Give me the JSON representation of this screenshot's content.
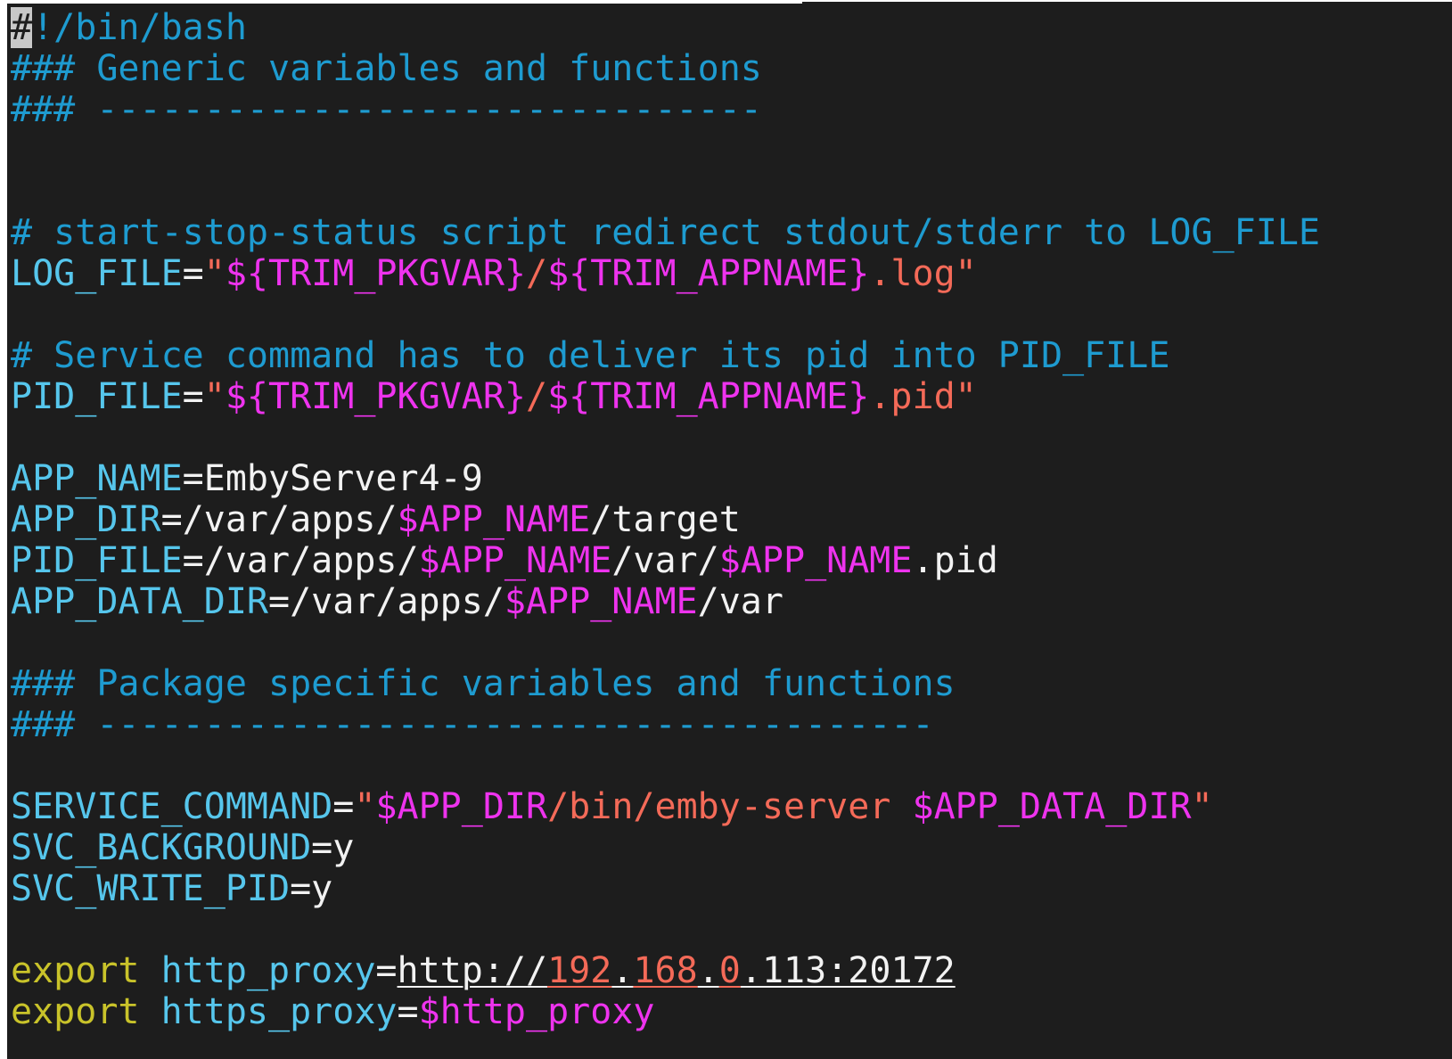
{
  "theme": {
    "background": "#1d1d1d",
    "text": "#f2f2f2",
    "comment": "#1e9bd0",
    "variable": "#56c6ec",
    "substitution": "#ee33ee",
    "string": "#f46a58",
    "keyword": "#c9c32a",
    "cursor": "#c8c8c8"
  },
  "editor": {
    "lines": [
      [
        {
          "t": "#",
          "c": "cursor"
        },
        {
          "t": "!/bin/bash",
          "c": "comment"
        }
      ],
      [
        {
          "t": "### Generic variables and functions",
          "c": "comment"
        }
      ],
      [
        {
          "t": "### -------------------------------",
          "c": "comment"
        }
      ],
      [],
      [],
      [
        {
          "t": "# start-stop-status script redirect stdout/stderr to LOG_FILE",
          "c": "comment"
        }
      ],
      [
        {
          "t": "LOG_FILE",
          "c": "variable"
        },
        {
          "t": "=",
          "c": "text"
        },
        {
          "t": "\"",
          "c": "string"
        },
        {
          "t": "${TRIM_PKGVAR}",
          "c": "substitution"
        },
        {
          "t": "/",
          "c": "string"
        },
        {
          "t": "${TRIM_APPNAME}",
          "c": "substitution"
        },
        {
          "t": ".log\"",
          "c": "string"
        }
      ],
      [],
      [
        {
          "t": "# Service command has to deliver its pid into PID_FILE",
          "c": "comment"
        }
      ],
      [
        {
          "t": "PID_FILE",
          "c": "variable"
        },
        {
          "t": "=",
          "c": "text"
        },
        {
          "t": "\"",
          "c": "string"
        },
        {
          "t": "${TRIM_PKGVAR}",
          "c": "substitution"
        },
        {
          "t": "/",
          "c": "string"
        },
        {
          "t": "${TRIM_APPNAME}",
          "c": "substitution"
        },
        {
          "t": ".pid\"",
          "c": "string"
        }
      ],
      [],
      [
        {
          "t": "APP_NAME",
          "c": "variable"
        },
        {
          "t": "=EmbyServer4-9",
          "c": "text"
        }
      ],
      [
        {
          "t": "APP_DIR",
          "c": "variable"
        },
        {
          "t": "=/var/apps/",
          "c": "text"
        },
        {
          "t": "$APP_NAME",
          "c": "substitution"
        },
        {
          "t": "/target",
          "c": "text"
        }
      ],
      [
        {
          "t": "PID_FILE",
          "c": "variable"
        },
        {
          "t": "=/var/apps/",
          "c": "text"
        },
        {
          "t": "$APP_NAME",
          "c": "substitution"
        },
        {
          "t": "/var/",
          "c": "text"
        },
        {
          "t": "$APP_NAME",
          "c": "substitution"
        },
        {
          "t": ".pid",
          "c": "text"
        }
      ],
      [
        {
          "t": "APP_DATA_DIR",
          "c": "variable"
        },
        {
          "t": "=/var/apps/",
          "c": "text"
        },
        {
          "t": "$APP_NAME",
          "c": "substitution"
        },
        {
          "t": "/var",
          "c": "text"
        }
      ],
      [],
      [
        {
          "t": "### Package specific variables and functions",
          "c": "comment"
        }
      ],
      [
        {
          "t": "### ---------------------------------------",
          "c": "comment"
        }
      ],
      [],
      [
        {
          "t": "SERVICE_COMMAND",
          "c": "variable"
        },
        {
          "t": "=",
          "c": "text"
        },
        {
          "t": "\"",
          "c": "string"
        },
        {
          "t": "$APP_DIR",
          "c": "substitution"
        },
        {
          "t": "/bin/emby-server ",
          "c": "string"
        },
        {
          "t": "$APP_DATA_DIR",
          "c": "substitution"
        },
        {
          "t": "\"",
          "c": "string"
        }
      ],
      [
        {
          "t": "SVC_BACKGROUND",
          "c": "variable"
        },
        {
          "t": "=y",
          "c": "text"
        }
      ],
      [
        {
          "t": "SVC_WRITE_PID",
          "c": "variable"
        },
        {
          "t": "=y",
          "c": "text"
        }
      ],
      [],
      [
        {
          "t": "export",
          "c": "keyword"
        },
        {
          "t": " ",
          "c": "text"
        },
        {
          "t": "http_proxy",
          "c": "variable"
        },
        {
          "t": "=",
          "c": "text"
        },
        {
          "t": "http://",
          "c": "text",
          "u": true
        },
        {
          "t": "192",
          "c": "string",
          "u": true
        },
        {
          "t": ".",
          "c": "text",
          "u": true
        },
        {
          "t": "168",
          "c": "string",
          "u": true
        },
        {
          "t": ".",
          "c": "text",
          "u": true
        },
        {
          "t": "0",
          "c": "string",
          "u": true
        },
        {
          "t": ".113:20172",
          "c": "text",
          "u": true
        }
      ],
      [
        {
          "t": "export",
          "c": "keyword"
        },
        {
          "t": " ",
          "c": "text"
        },
        {
          "t": "https_proxy",
          "c": "variable"
        },
        {
          "t": "=",
          "c": "text"
        },
        {
          "t": "$http_proxy",
          "c": "substitution"
        }
      ]
    ]
  }
}
